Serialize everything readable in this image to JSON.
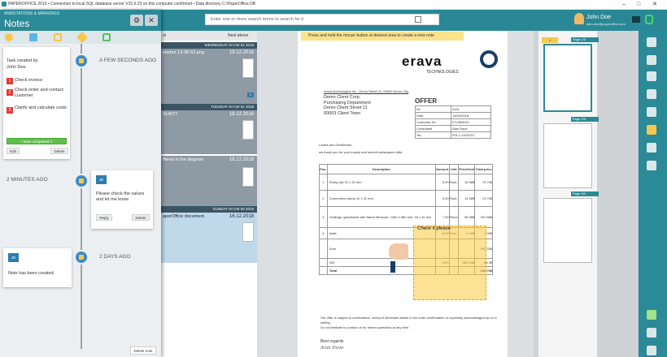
{
  "window": {
    "title": "PAPEROFFICE 2019 • Connection to local SQL database server V15.6.23 on this computer confirmed • Data directory C:\\PaperOffice DB"
  },
  "search": {
    "placeholder": "Enter one or more search terms to search for it"
  },
  "user": {
    "name": "John Doe",
    "email": "john.doe@paperoffice.com"
  },
  "notes_panel": {
    "subtitle": "ANNOTATIONS & MARKINGS",
    "title": "Notes",
    "delete_label": "Delete note"
  },
  "task_note": {
    "created": "Task created by",
    "author": "John Doe",
    "items": [
      {
        "n": "1",
        "text": "Check invoice"
      },
      {
        "n": "2",
        "text": "Check order and contact customer"
      },
      {
        "n": "3",
        "text": "Clarify and calculate costs"
      }
    ],
    "done_label": "I have completed it",
    "edit": "Edit",
    "delete": "Delete",
    "when": "A FEW SECONDS AGO"
  },
  "comment_note": {
    "avatar": "JD",
    "text": "Please check the values and let me know",
    "reply": "Reply",
    "delete": "Delete",
    "when": "2 MINUTES AGO"
  },
  "created_note": {
    "avatar": "JD",
    "text": "Note has been created",
    "when": "2 DAYS AGO"
  },
  "list": {
    "sort": "xt",
    "above": "Next above",
    "groups": [
      {
        "label": "WEDNESDAY IN CW 51 2018"
      },
      {
        "label": "TUESDAY IN CW 51 2018"
      },
      {
        "label": "SUNDAY IN CW 50 2018"
      }
    ],
    "items": [
      {
        "name": "enshot 13-38-53.png",
        "date": "19.12.2018"
      },
      {
        "name": "314077",
        "date": "18.12.2018"
      },
      {
        "name": "ffered in the diagram",
        "date": "18.12.2018"
      },
      {
        "name": "aperOffice document",
        "date": "16.12.2018"
      }
    ]
  },
  "document": {
    "hint": "Press and hold the mouse button at desired area to create a new note",
    "logo": "erava",
    "logo_sub": "TECHNOLOGIES",
    "sender_line": "erava technologies Inc., Demo Street 11, 00000 Demo City",
    "address": [
      "Demo Client Corp.",
      "Purchasing Department",
      "Demo Client Street 11",
      "00003 Client Town"
    ],
    "offer_title": "OFFER",
    "offer_rows": [
      {
        "k": "Nr.",
        "v": "A111"
      },
      {
        "k": "Date",
        "v": "15/04/2018"
      },
      {
        "k": "Customer-No",
        "v": "KY2564321"
      },
      {
        "k": "Consultant",
        "v": "Alan Dave"
      },
      {
        "k": "Tel.:",
        "v": "001.1.1222222"
      }
    ],
    "greeting": "Ladies and Gentlemen,",
    "intro": "we thank you for your inquiry and submit subsequent offer.",
    "table_headers": [
      "Pos.",
      "Description",
      "Amount",
      "Unit",
      "Price/Unit",
      "Total price"
    ],
    "table_rows": [
      {
        "pos": "1",
        "desc": "Fixing clip 31 x 31 mm",
        "amount": "5.00",
        "unit": "Pack",
        "price": "15.98$",
        "total": "79.74$"
      },
      {
        "pos": "2",
        "desc": "Connection clamp 31 x 31 mm",
        "amount": "5.00",
        "unit": "Pack",
        "price": "14.98$",
        "total": "74.74$"
      },
      {
        "pos": "3",
        "desc": "Gratings, galvanized with frame Measure: 1280 x 680 mm; 30 x 30 mm",
        "amount": "7.00",
        "unit": "Piece",
        "price": "55.98$",
        "total": "391.86$"
      },
      {
        "pos": "4",
        "desc": "Nails",
        "amount": "8.00",
        "unit": "Pack",
        "price": "1.00$",
        "total": "7.00$"
      }
    ],
    "sum_label": "Sum",
    "sum_value": "552.33$",
    "vat_label": "VAT",
    "vat_rate": "16%",
    "vat_base": "552.33$",
    "vat_value": "88.3$",
    "total_label": "Total",
    "total_value": "640.70$",
    "sticky": "Check it please",
    "closing": "Our offer is subject to confirmation, except if otherwise stated in the order confirmation or expressly acknowledged by us in writing.",
    "closing2": "Do not hesitate to contact us for further questions at any time.",
    "regards": "Best regards",
    "signature": "Alan Dave"
  },
  "thumbs": {
    "pages": [
      "Page 1/3",
      "Page 2/3",
      "Page 3/3"
    ],
    "counter": "1"
  }
}
